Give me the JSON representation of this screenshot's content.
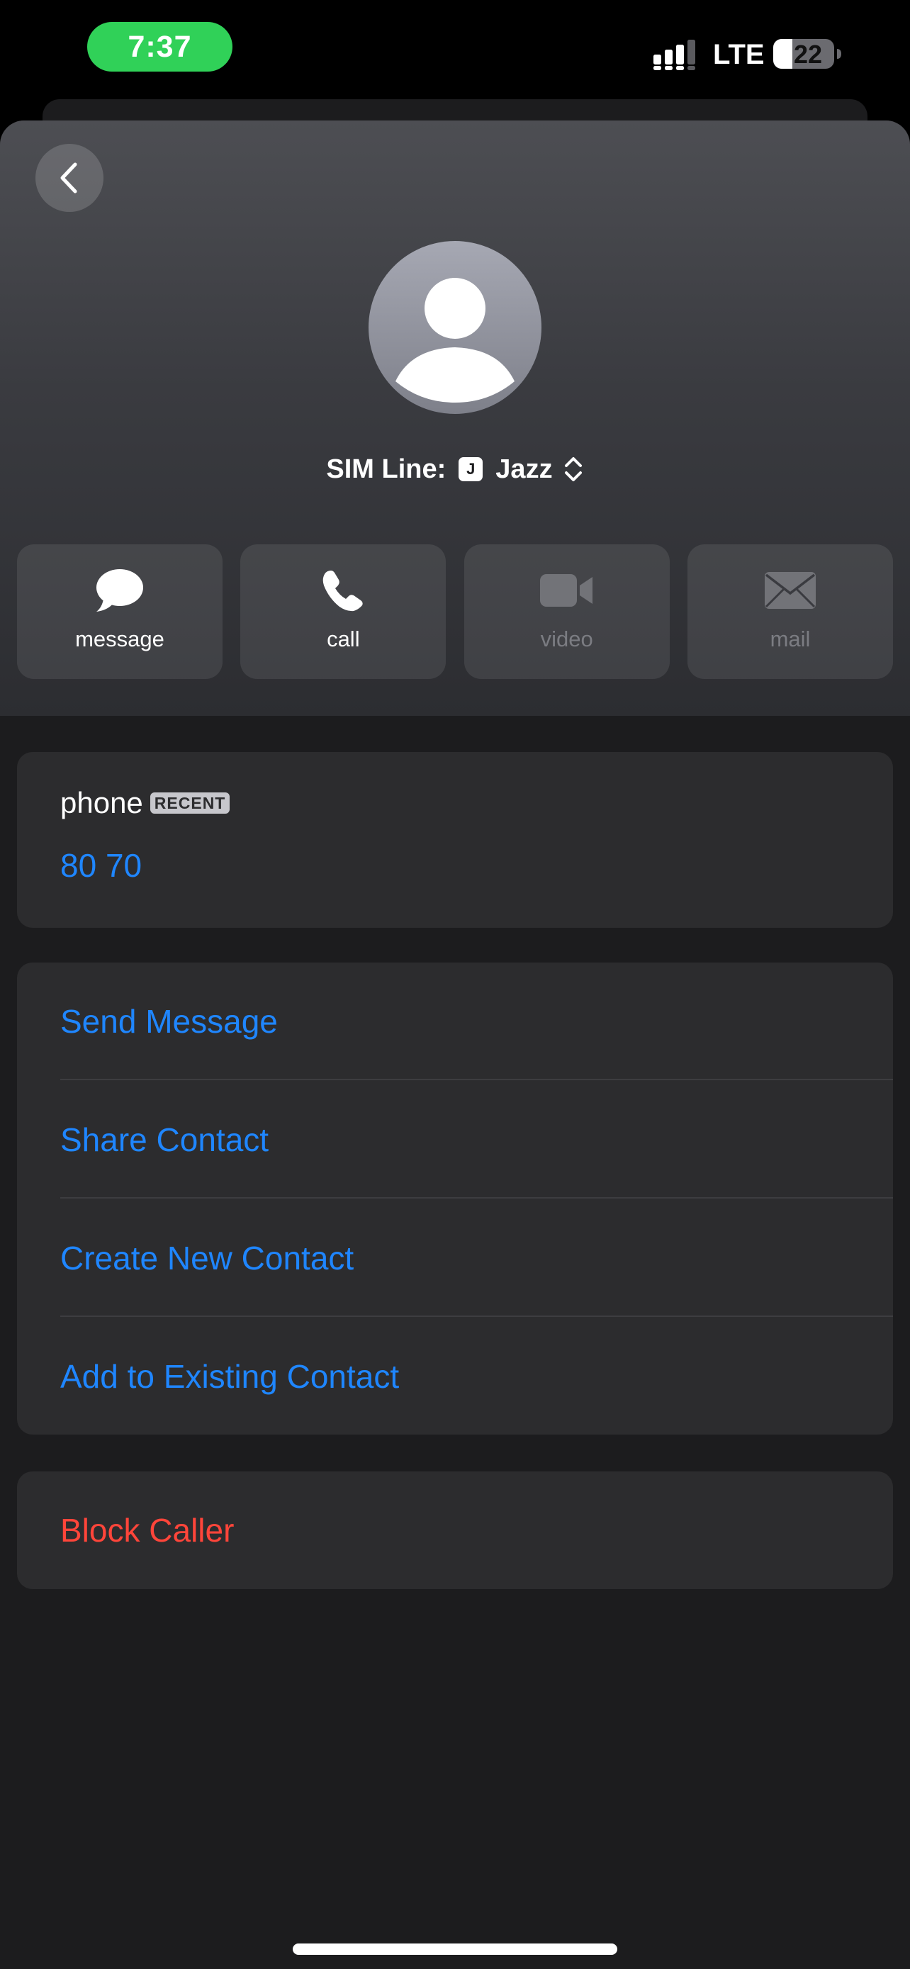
{
  "status_bar": {
    "time": "7:37",
    "network": "LTE",
    "battery_level": "22",
    "time_pill_color": "#30d158"
  },
  "header": {
    "back_icon": "chevron-left-icon",
    "avatar_icon": "person-silhouette-icon",
    "sim_line": {
      "label": "SIM Line:",
      "badge": "J",
      "carrier": "Jazz",
      "icon": "chevron-up-down-icon"
    },
    "actions": [
      {
        "label": "message",
        "icon": "message-bubble-icon",
        "enabled": true
      },
      {
        "label": "call",
        "icon": "phone-icon",
        "enabled": true
      },
      {
        "label": "video",
        "icon": "video-camera-icon",
        "enabled": false
      },
      {
        "label": "mail",
        "icon": "envelope-icon",
        "enabled": false
      }
    ]
  },
  "phone_card": {
    "label": "phone",
    "badge": "RECENT",
    "number": "80 70"
  },
  "action_list": {
    "items": [
      {
        "label": "Send Message"
      },
      {
        "label": "Share Contact"
      },
      {
        "label": "Create New Contact"
      },
      {
        "label": "Add to Existing Contact"
      }
    ]
  },
  "block": {
    "label": "Block Caller"
  },
  "colors": {
    "link_blue": "#1f86ff",
    "destructive_red": "#ff453a",
    "card_background": "#2c2c2e",
    "sheet_background": "#1c1c1e"
  }
}
